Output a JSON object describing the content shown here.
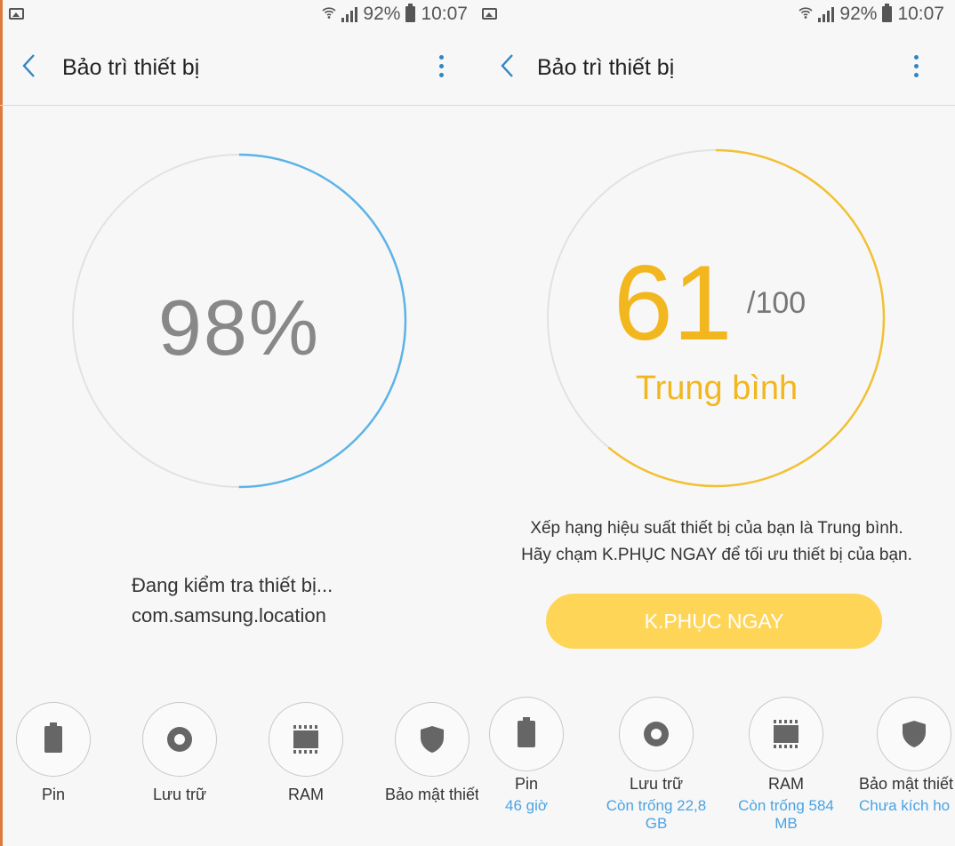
{
  "left": {
    "status": {
      "battery": "92%",
      "time": "10:07"
    },
    "appbar": {
      "title": "Bảo trì thiết bị"
    },
    "progress": {
      "text": "98%",
      "value": 0.98
    },
    "checking": {
      "line1": "Đang kiểm tra thiết bị...",
      "line2": "com.samsung.location"
    },
    "tiles": [
      {
        "label": "Pin",
        "icon": "battery-icon"
      },
      {
        "label": "Lưu trữ",
        "icon": "storage-icon"
      },
      {
        "label": "RAM",
        "icon": "ram-icon"
      },
      {
        "label": "Bảo mật thiết",
        "icon": "shield-icon"
      }
    ]
  },
  "right": {
    "status": {
      "battery": "92%",
      "time": "10:07"
    },
    "appbar": {
      "title": "Bảo trì thiết bị"
    },
    "score": {
      "value": "61",
      "total": "/100",
      "label": "Trung bình",
      "fraction": 0.61
    },
    "description": {
      "line1": "Xếp hạng hiệu suất thiết bị của bạn là Trung bình.",
      "line2": "Hãy chạm K.PHỤC NGAY để tối ưu thiết bị của bạn."
    },
    "fix_button": "K.PHỤC NGAY",
    "tiles": [
      {
        "label": "Pin",
        "sub": "46 giờ",
        "icon": "battery-icon"
      },
      {
        "label": "Lưu trữ",
        "sub": "Còn trống 22,8 GB",
        "icon": "storage-icon"
      },
      {
        "label": "RAM",
        "sub": "Còn trống 584 MB",
        "icon": "ram-icon"
      },
      {
        "label": "Bảo mật thiết",
        "sub": "Chưa kích ho",
        "icon": "shield-icon"
      }
    ]
  },
  "colors": {
    "accent_blue": "#4aa3e3",
    "score_yellow": "#f2b71f",
    "button_yellow": "#ffd558"
  }
}
